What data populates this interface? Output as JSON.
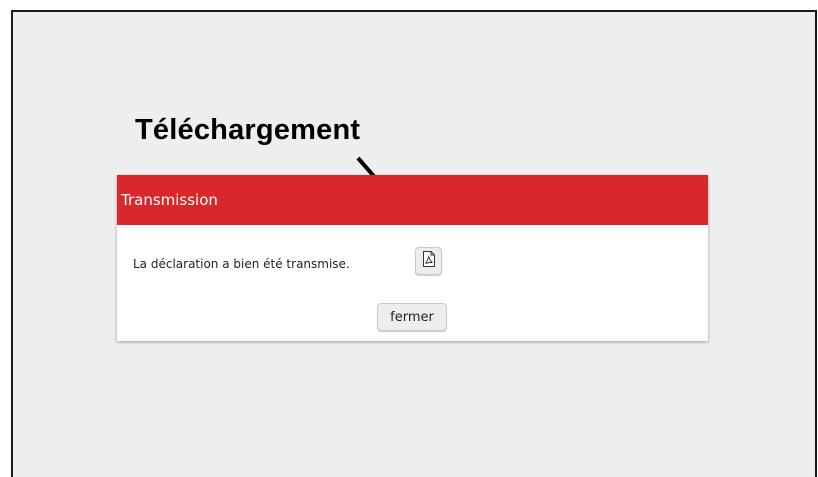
{
  "annotation": {
    "label": "Téléchargement"
  },
  "dialog": {
    "title": "Transmission",
    "message": "La déclaration a bien été transmise.",
    "download_icon": "pdf-document-icon",
    "close_label": "fermer"
  },
  "colors": {
    "header": "#d9282c",
    "background": "#edeef0",
    "button": "#ededed"
  }
}
